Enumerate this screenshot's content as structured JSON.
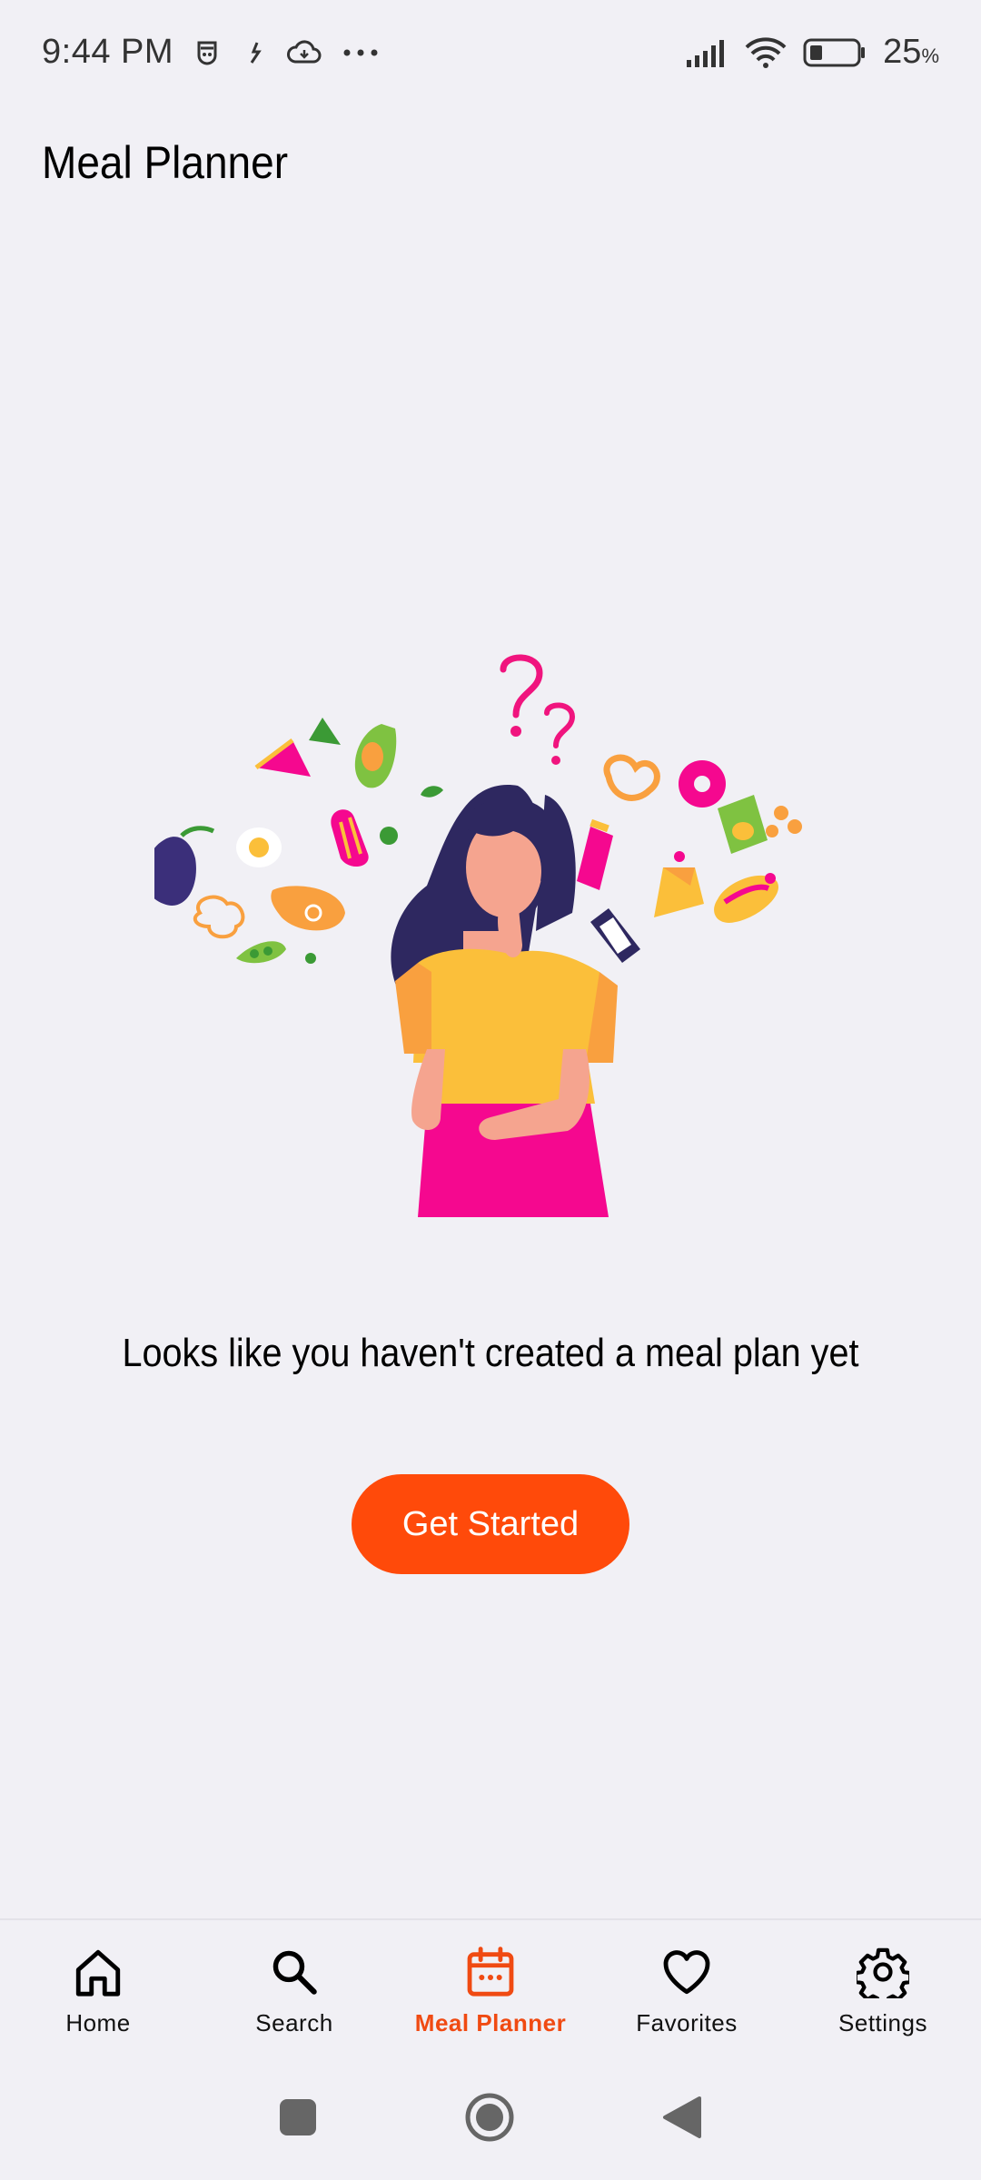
{
  "status_bar": {
    "time": "9:44 PM",
    "battery_percent": "25",
    "battery_unit": "%",
    "icons": [
      "face-icon",
      "sync-icon",
      "cloud-icon",
      "more-icon",
      "signal-icon",
      "wifi-icon",
      "battery-icon"
    ]
  },
  "page": {
    "title": "Meal Planner"
  },
  "empty_state": {
    "illustration": "thinking-woman-food-illustration",
    "message": "Looks like you haven't created a meal plan yet",
    "button_label": "Get Started"
  },
  "bottom_nav": {
    "active_color": "#f04a12",
    "items": [
      {
        "label": "Home",
        "icon": "home-icon"
      },
      {
        "label": "Search",
        "icon": "search-icon"
      },
      {
        "label": "Meal Planner",
        "icon": "calendar-icon",
        "active": true
      },
      {
        "label": "Favorites",
        "icon": "heart-icon"
      },
      {
        "label": "Settings",
        "icon": "gear-icon"
      }
    ]
  },
  "system_nav": {
    "buttons": [
      "recents-button",
      "home-button",
      "back-button"
    ]
  },
  "colors": {
    "background": "#f1f0f5",
    "accent": "#ff4a0a"
  }
}
